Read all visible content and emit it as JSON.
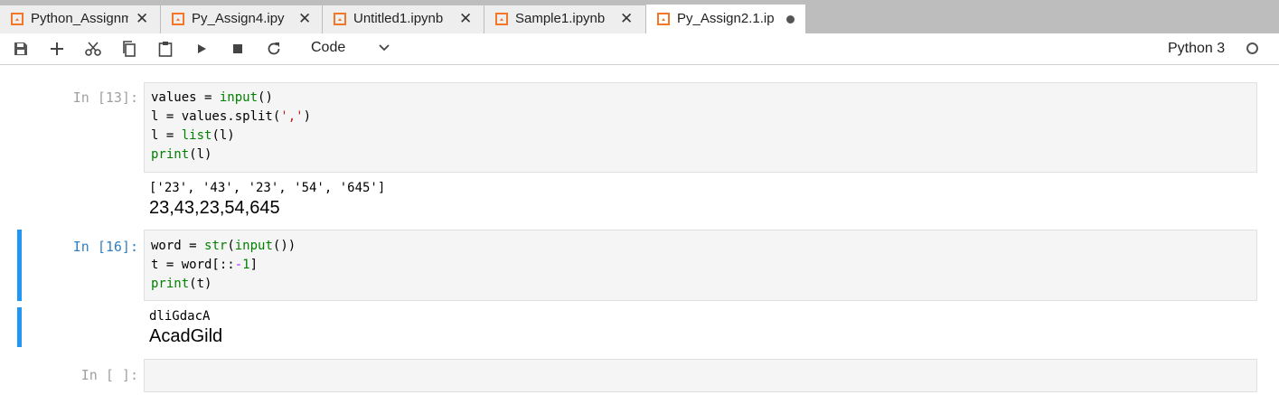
{
  "tabs": [
    {
      "label": "Python_Assignm",
      "closable": true,
      "active": false
    },
    {
      "label": "Py_Assign4.ipy",
      "closable": true,
      "active": false
    },
    {
      "label": "Untitled1.ipynb",
      "closable": true,
      "active": false
    },
    {
      "label": "Sample1.ipynb",
      "closable": true,
      "active": false
    },
    {
      "label": "Py_Assign2.1.ip",
      "closable": false,
      "active": true,
      "unsaved": true
    }
  ],
  "toolbar": {
    "buttons": [
      "save-icon",
      "add-icon",
      "cut-icon",
      "copy-icon",
      "paste-icon",
      "run-icon",
      "stop-icon",
      "restart-icon"
    ],
    "cell_type": "Code",
    "kernel_name": "Python 3",
    "kernel_status": "idle"
  },
  "cells": [
    {
      "prompt": "In [13]:",
      "source": [
        "values = input()",
        "l = values.split(',')",
        "l = list(l)",
        "print(l)"
      ],
      "output": [
        "['23', '43', '23', '54', '645']"
      ],
      "stdin": "23,43,23,54,645"
    },
    {
      "prompt": "In [16]:",
      "source": [
        "word = str(input())",
        "t = word[::-1]",
        "print(t)"
      ],
      "output": [
        "dliGdacA"
      ],
      "stdin": "AcadGild"
    },
    {
      "prompt": "In [ ]:",
      "source": []
    }
  ],
  "colors": {
    "accent": "#2196f3",
    "tab_icon": "#f37726",
    "keyword": "#008000",
    "string": "#ba2121",
    "operator": "#aa22ff"
  }
}
